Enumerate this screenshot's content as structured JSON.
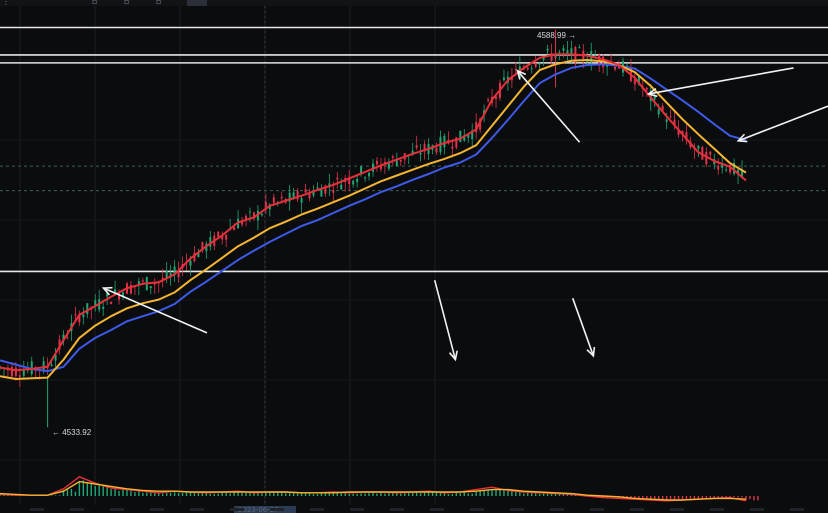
{
  "chart_data": {
    "type": "candlestick",
    "title": "",
    "xlabel": "",
    "ylabel": "",
    "ylim": [
      4528,
      4592
    ],
    "price_labels": {
      "high": "4588.99 →",
      "low": "← 4533.92"
    },
    "high_value": 4588.99,
    "low_value": 4533.92,
    "horizontal_levels": [
      4589.3,
      4585.5,
      4584.4,
      4555.5
    ],
    "dashed_levels": [
      4570.1,
      4566.7
    ],
    "series": [
      {
        "name": "",
        "color": "#e8303b",
        "values": [
          4542.2,
          4541.8,
          4542.0,
          4542.3,
          4546.0,
          4549.5,
          4550.7,
          4552.0,
          4553.2,
          4553.8,
          4554.0,
          4555.1,
          4557.3,
          4559.0,
          4560.5,
          4562.3,
          4563.0,
          4564.6,
          4565.3,
          4566.0,
          4566.8,
          4567.5,
          4568.4,
          4569.3,
          4570.2,
          4571.0,
          4571.8,
          4572.5,
          4573.3,
          4573.9,
          4575.2,
          4579.3,
          4582.0,
          4583.7,
          4585.1,
          4585.6,
          4585.6,
          4585.4,
          4584.9,
          4584.1,
          4582.3,
          4579.6,
          4577.0,
          4574.5,
          4572.0,
          4570.8,
          4570.0,
          4568.1
        ]
      },
      {
        "name": "",
        "color": "#f5b530",
        "values": [
          4541.0,
          4540.6,
          4540.7,
          4540.8,
          4543.3,
          4546.3,
          4548.0,
          4549.3,
          4550.4,
          4551.1,
          4551.6,
          4552.6,
          4554.3,
          4555.8,
          4557.4,
          4559.0,
          4560.2,
          4561.5,
          4562.4,
          4563.4,
          4564.2,
          4565.1,
          4566.0,
          4567.0,
          4568.0,
          4568.8,
          4569.6,
          4570.4,
          4571.1,
          4571.9,
          4573.0,
          4575.7,
          4578.4,
          4581.1,
          4583.4,
          4584.2,
          4584.7,
          4584.8,
          4584.6,
          4584.1,
          4583.1,
          4581.2,
          4578.9,
          4576.6,
          4574.5,
          4572.5,
          4570.5,
          4569.2
        ]
      },
      {
        "name": "",
        "color": "#3d5ae8",
        "values": [
          4543.2,
          4542.6,
          4542.0,
          4541.7,
          4542.3,
          4544.8,
          4546.3,
          4547.4,
          4548.6,
          4549.3,
          4550.0,
          4551.0,
          4552.7,
          4554.1,
          4555.6,
          4557.1,
          4558.4,
          4559.6,
          4560.7,
          4561.8,
          4562.6,
          4563.6,
          4564.6,
          4565.5,
          4566.5,
          4567.3,
          4568.2,
          4569.0,
          4569.9,
          4570.6,
          4571.7,
          4574.0,
          4576.5,
          4579.1,
          4581.6,
          4582.8,
          4583.7,
          4584.1,
          4584.2,
          4584.0,
          4583.6,
          4582.2,
          4580.7,
          4579.2,
          4577.6,
          4575.9,
          4574.3,
          4573.7
        ]
      }
    ],
    "indicator_series": [
      {
        "name": "",
        "color": "#e8303b",
        "values": [
          0.2,
          0.1,
          0.1,
          0.1,
          0.9,
          2.4,
          1.6,
          1.0,
          0.8,
          0.6,
          0.4,
          0.6,
          0.5,
          0.4,
          0.5,
          0.6,
          0.4,
          0.5,
          0.5,
          0.4,
          0.4,
          0.5,
          0.4,
          0.5,
          0.5,
          0.4,
          0.5,
          0.6,
          0.4,
          0.5,
          0.8,
          1.1,
          0.7,
          0.5,
          0.4,
          0.3,
          0.2,
          0.0,
          -0.2,
          -0.3,
          -0.4,
          -0.5,
          -0.6,
          -0.5,
          -0.4,
          -0.3,
          -0.2,
          -0.6
        ]
      },
      {
        "name": "",
        "color": "#f5b530",
        "values": [
          0.3,
          0.2,
          0.1,
          0.1,
          0.6,
          1.8,
          1.5,
          1.2,
          0.9,
          0.7,
          0.6,
          0.6,
          0.5,
          0.5,
          0.5,
          0.5,
          0.5,
          0.5,
          0.5,
          0.4,
          0.4,
          0.4,
          0.5,
          0.5,
          0.5,
          0.5,
          0.5,
          0.5,
          0.5,
          0.5,
          0.6,
          0.8,
          0.8,
          0.6,
          0.5,
          0.4,
          0.3,
          0.1,
          0.0,
          -0.1,
          -0.3,
          -0.4,
          -0.5,
          -0.5,
          -0.4,
          -0.3,
          -0.3,
          -0.4
        ]
      }
    ],
    "annotations": [
      {
        "kind": "arrow",
        "from": [
          30,
          4547.0
        ],
        "to": [
          15,
          4553.2
        ]
      },
      {
        "kind": "arrow",
        "from": [
          84,
          4573.4
        ],
        "to": [
          75,
          4583.3
        ]
      },
      {
        "kind": "arrow",
        "from": [
          63,
          4554.3
        ],
        "to": [
          66,
          4543.3
        ]
      },
      {
        "kind": "arrow",
        "from": [
          83,
          4551.8
        ],
        "to": [
          86,
          4543.8
        ]
      },
      {
        "kind": "arrow",
        "from": [
          115,
          4583.7
        ],
        "to": [
          94,
          4580.1
        ]
      },
      {
        "kind": "arrow",
        "from": [
          120,
          4578.4
        ],
        "to": [
          107,
          4573.6
        ]
      }
    ],
    "grid": true,
    "legend": "none"
  },
  "timeline": {
    "highlight_label": "2023-06-27"
  }
}
